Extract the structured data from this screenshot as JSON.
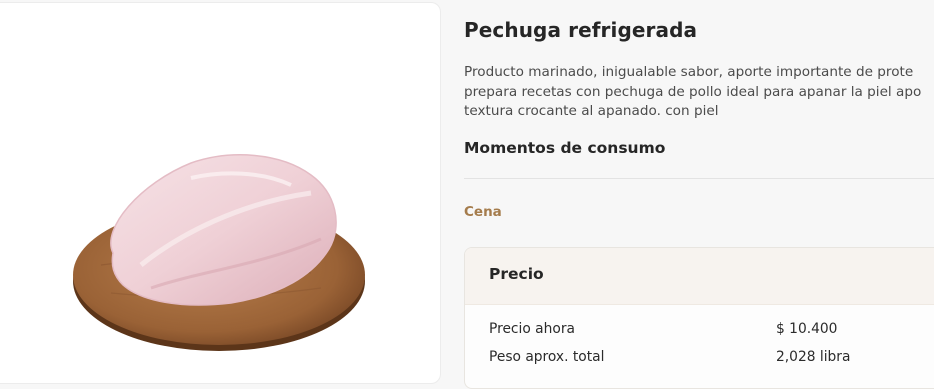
{
  "product": {
    "title": "Pechuga refrigerada",
    "description_lines": [
      "Producto marinado, inigualable sabor, aporte importante de prote",
      "prepara recetas con pechuga de pollo ideal para apanar la piel apo",
      "textura crocante al apanado. con piel"
    ]
  },
  "consumption": {
    "heading": "Momentos de consumo",
    "moments": [
      "Cena"
    ]
  },
  "price": {
    "heading": "Precio",
    "rows": [
      {
        "label": "Precio ahora",
        "value": "$ 10.400"
      },
      {
        "label": "Peso aprox. total",
        "value": "2,028 libra"
      }
    ]
  },
  "colors": {
    "accent": "#a57c4c",
    "price_header_bg": "#f7f3ef",
    "page_bg": "#f7f7f7"
  }
}
